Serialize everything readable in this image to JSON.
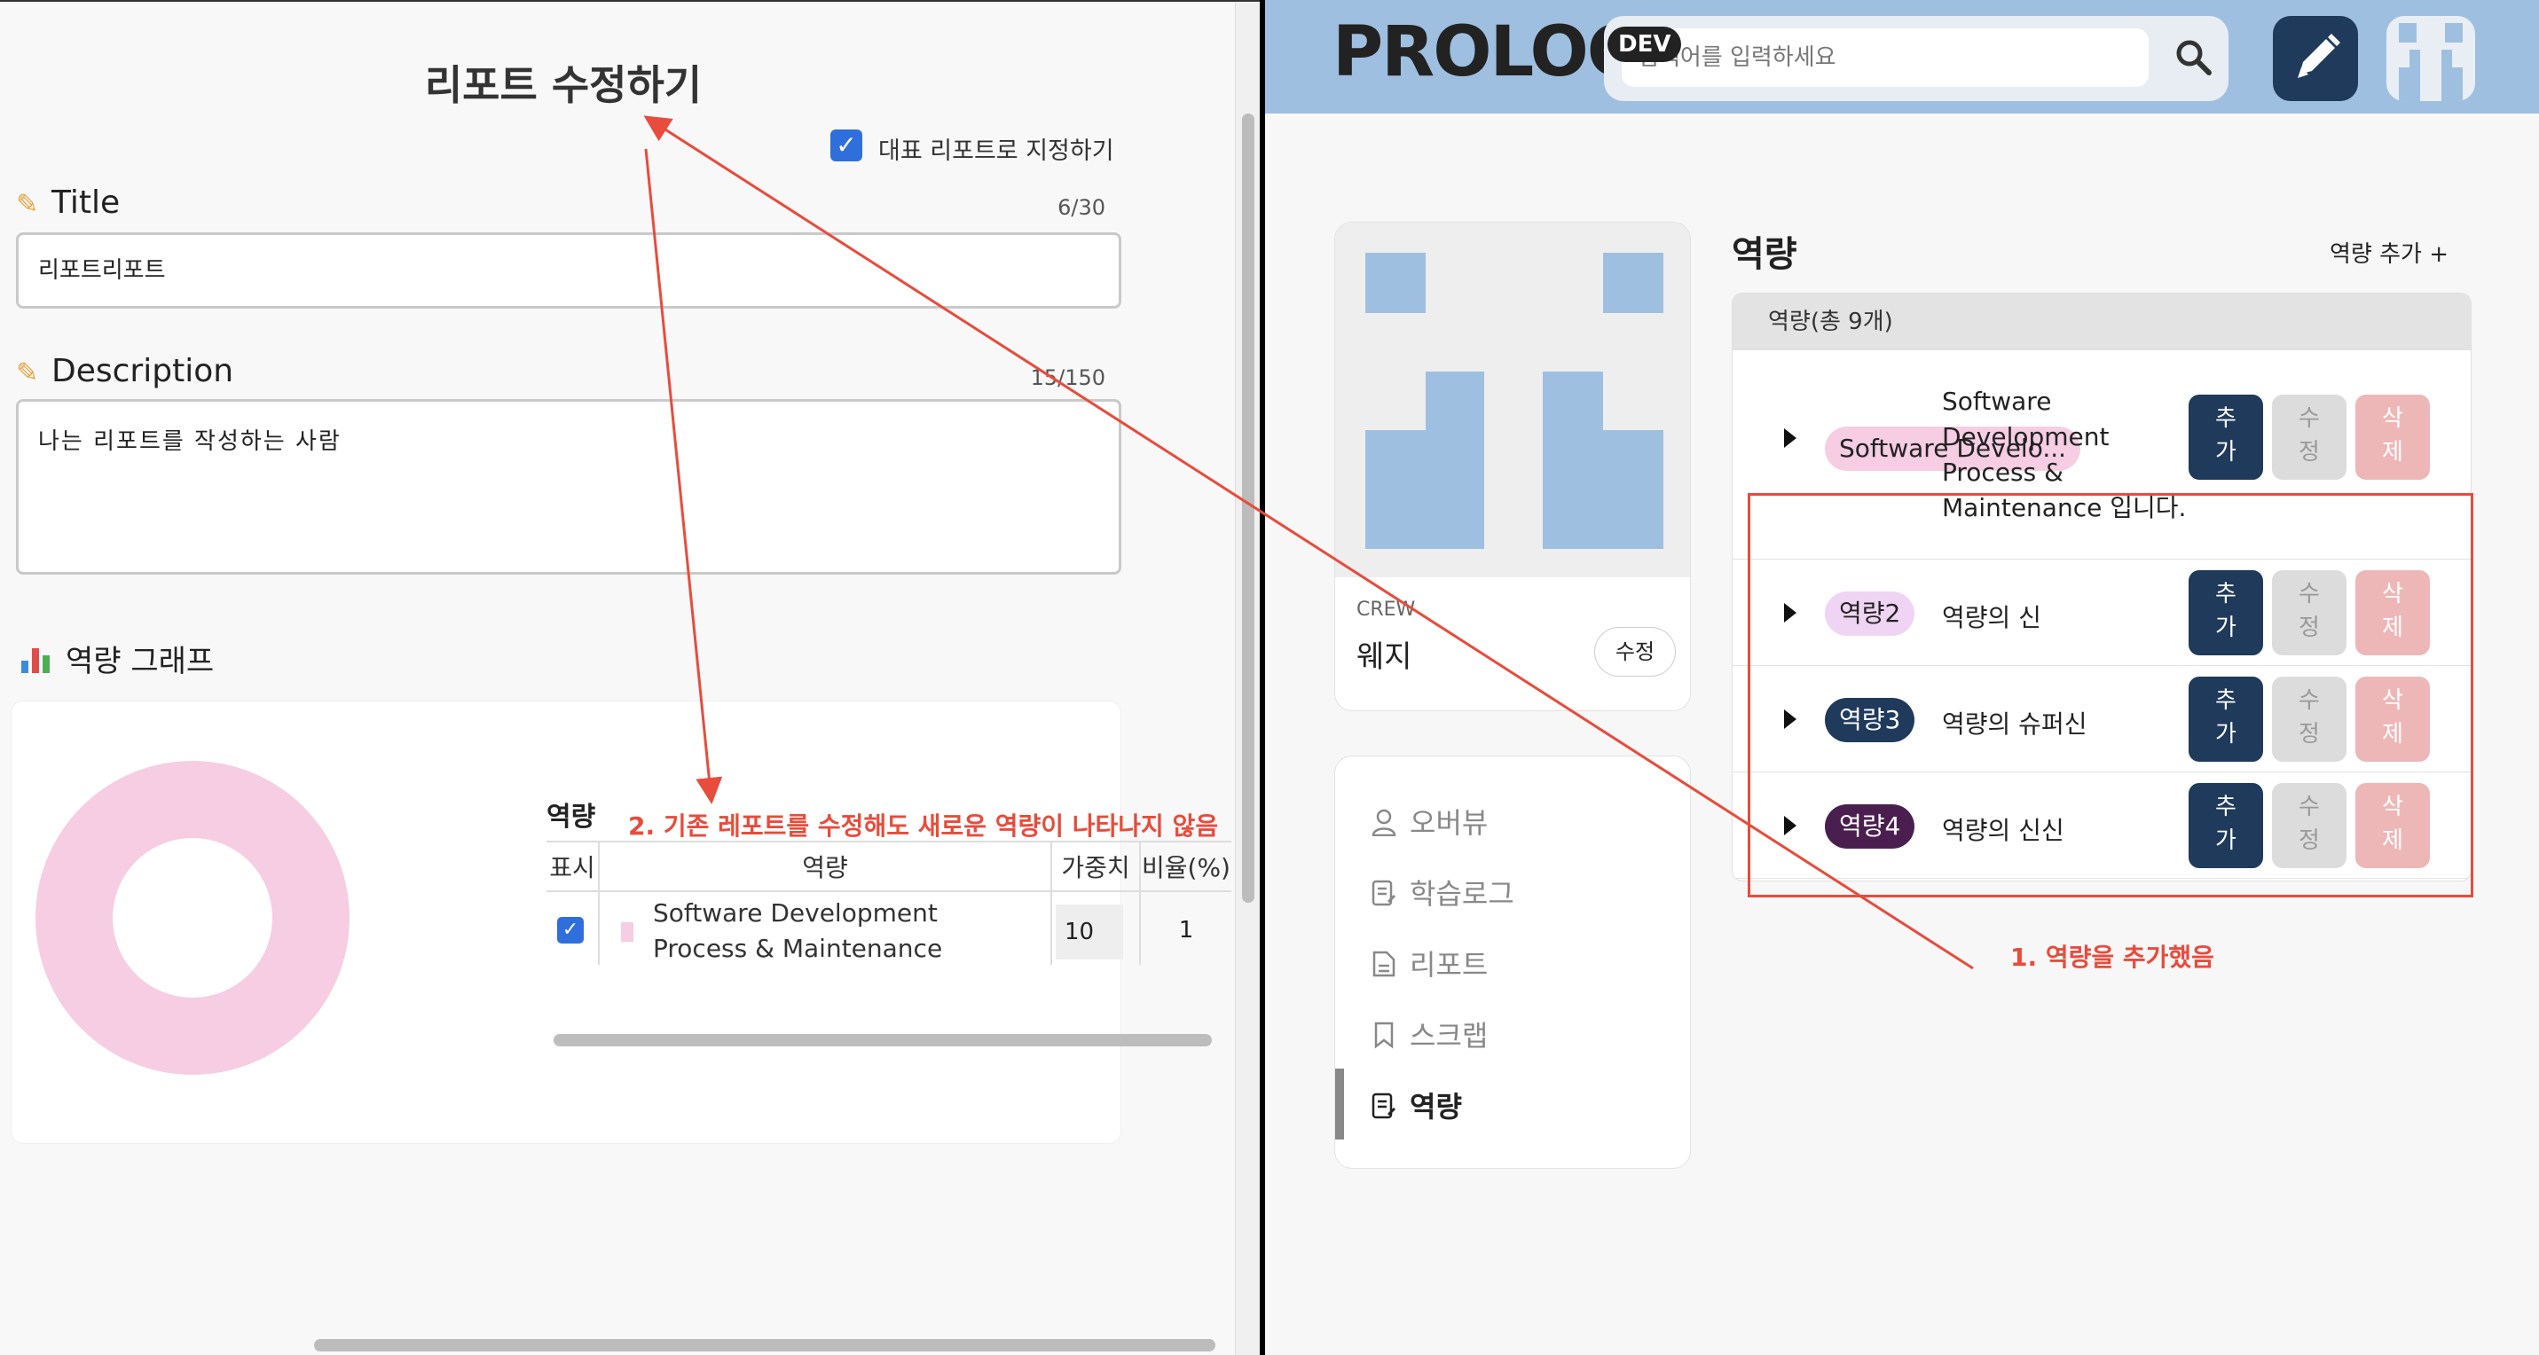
{
  "report_editor": {
    "page_title": "리포트 수정하기",
    "representative_label": "대표 리포트로 지정하기",
    "representative_checked": true,
    "title_label": "Title",
    "title_counter": "6/30",
    "title_value": "리포트리포트",
    "description_label": "Description",
    "description_counter": "15/150",
    "description_value": "나는 리포트를 작성하는 사람",
    "graph_label": "역량 그래프",
    "table": {
      "title": "역량",
      "columns": [
        "표시",
        "역량",
        "가중치",
        "비율(%)"
      ],
      "rows": [
        {
          "checked": true,
          "ability": "Software Development Process & Maintenance",
          "weight": "10",
          "ratio": "1",
          "color": "#f6cde3"
        }
      ]
    }
  },
  "annotations": {
    "note1": "1. 역량을 추가했음",
    "note2": "2. 기존 레포트를 수정해도 새로운 역량이 나타나지 않음",
    "color": "#e74c3c"
  },
  "prolog": {
    "logo": "PROLOG",
    "dev_badge": "DEV",
    "search_placeholder": "검색어를 입력하세요",
    "profile": {
      "role": "CREW",
      "name": "웨지",
      "edit_label": "수정"
    },
    "nav": [
      {
        "label": "오버뷰",
        "icon": "user-icon",
        "active": false
      },
      {
        "label": "학습로그",
        "icon": "post-icon",
        "active": false
      },
      {
        "label": "리포트",
        "icon": "report-icon",
        "active": false
      },
      {
        "label": "스크랩",
        "icon": "bookmark-icon",
        "active": false
      },
      {
        "label": "역량",
        "icon": "ability-icon",
        "active": true
      }
    ],
    "abilities": {
      "heading": "역량",
      "add_label": "역량 추가 +",
      "count_label": "역량(총 9개)",
      "buttons": {
        "add": "추가",
        "add_l1": "추",
        "add_l2": "가",
        "mod_l1": "수",
        "mod_l2": "정",
        "del_l1": "삭",
        "del_l2": "제"
      },
      "rows": [
        {
          "tag": "Software Develo...",
          "tag_bg": "#f6cde3",
          "tag_color": "#222222",
          "desc_lines": [
            "Software",
            "Development",
            "Process &",
            "Maintenance 입니다."
          ]
        },
        {
          "tag": "역량2",
          "tag_bg": "#f0d4f4",
          "tag_color": "#222222",
          "desc": "역량의 신"
        },
        {
          "tag": "역량3",
          "tag_bg": "#1f3a5a",
          "tag_color": "#ffffff",
          "desc": "역량의 슈퍼신"
        },
        {
          "tag": "역량4",
          "tag_bg": "#4a1f4f",
          "tag_color": "#ffffff",
          "desc": "역량의 신신"
        }
      ]
    }
  }
}
